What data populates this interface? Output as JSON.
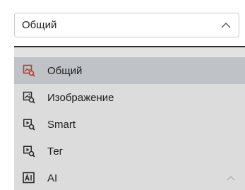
{
  "select": {
    "value": "Общий"
  },
  "dropdown": {
    "options": [
      {
        "label": "Общий",
        "icon": "general-image-icon",
        "selected": true
      },
      {
        "label": "Изображение",
        "icon": "image-search-icon",
        "selected": false
      },
      {
        "label": "Smart",
        "icon": "smart-video-icon",
        "selected": false
      },
      {
        "label": "Тег",
        "icon": "tag-video-icon",
        "selected": false
      },
      {
        "label": "AI",
        "icon": "ai-icon",
        "selected": false
      }
    ]
  },
  "colors": {
    "selected_icon": "#c0392b",
    "icon": "#2b2b2b",
    "selected_row": "#bfc3c7",
    "dropdown_bg": "#dcdcdc"
  }
}
